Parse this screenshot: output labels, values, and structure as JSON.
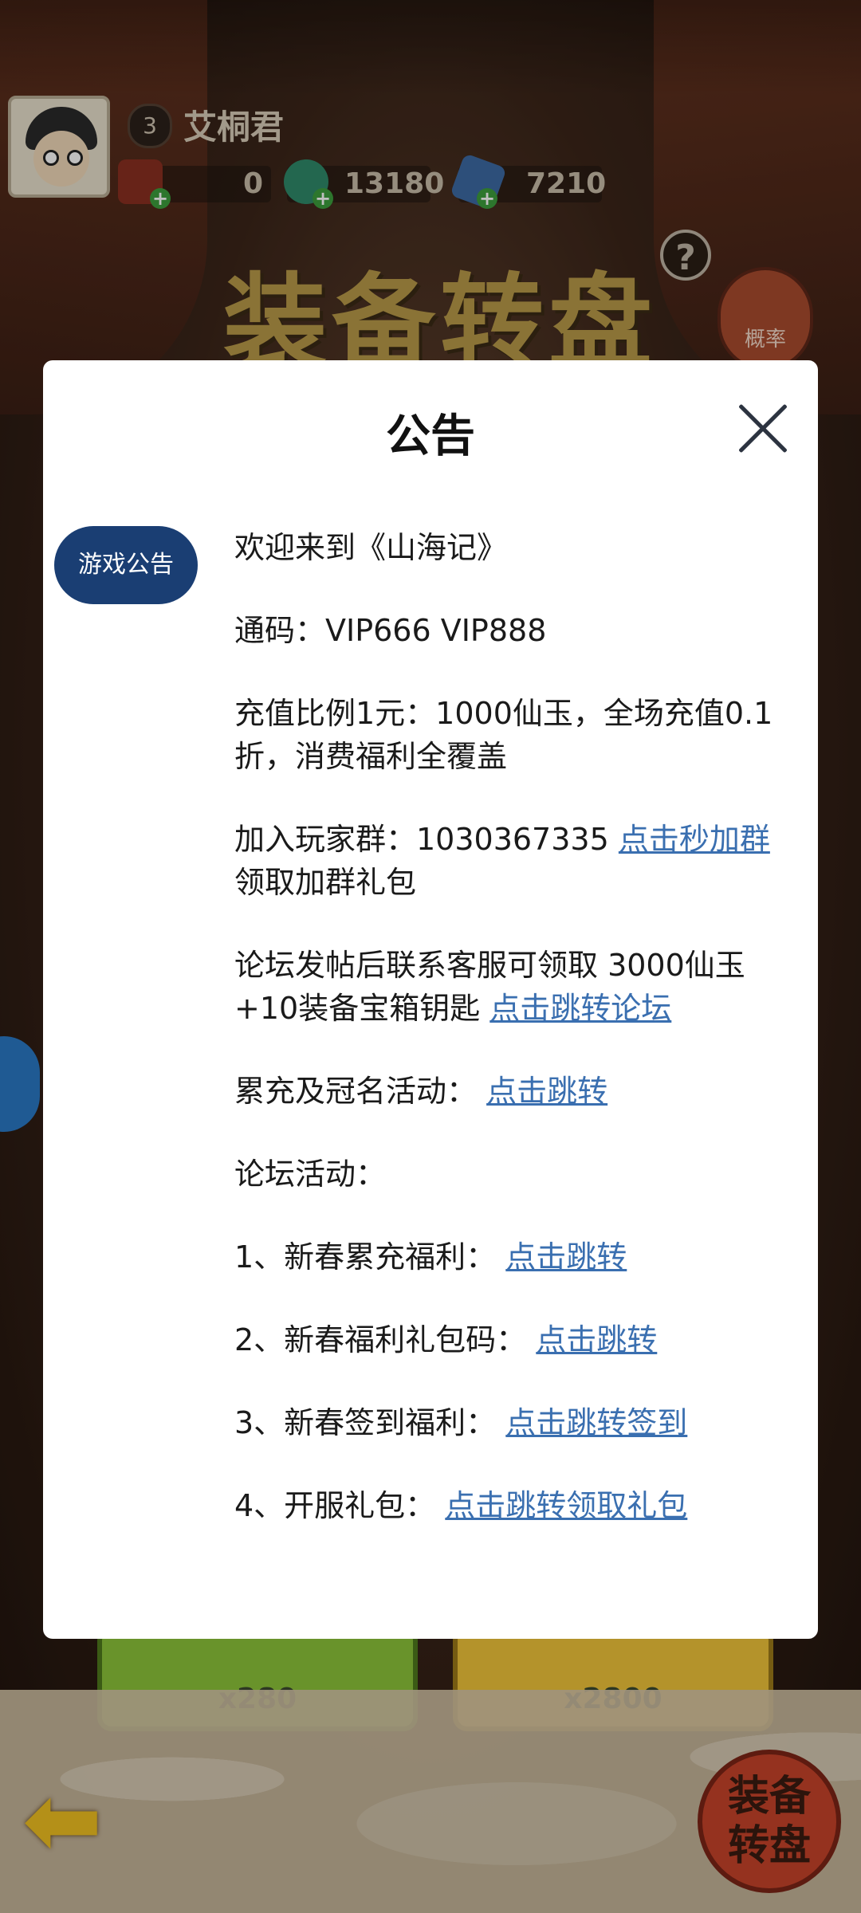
{
  "player": {
    "level": "3",
    "name": "艾桐君"
  },
  "resources": {
    "a": "0",
    "b": "13180",
    "c": "7210"
  },
  "background": {
    "title": "装备转盘",
    "help_symbol": "?",
    "prob_label": "概率",
    "btn_left_cost": "x280",
    "btn_right_cost": "x2800",
    "corner_label_line1": "装备",
    "corner_label_line2": "转盘"
  },
  "dialog": {
    "title": "公告",
    "tab": "游戏公告",
    "p1": "欢迎来到《山海记》",
    "p2": "通码：VIP666 VIP888",
    "p3": "充值比例1元：1000仙玉，全场充值0.1折，消费福利全覆盖",
    "p4_text": "加入玩家群：1030367335 ",
    "p4_link": "点击秒加群",
    "p4_tail": " 领取加群礼包",
    "p5_text": "论坛发帖后联系客服可领取 3000仙玉+10装备宝箱钥匙 ",
    "p5_link": "点击跳转论坛",
    "p6_text": "累充及冠名活动：",
    "p6_link": "点击跳转",
    "p7_text": "论坛活动：",
    "p8_text": "1、新春累充福利：",
    "p8_link": "点击跳转",
    "p9_text": "2、新春福利礼包码：",
    "p9_link": "点击跳转",
    "p10_text": "3、新春签到福利：",
    "p10_link": "点击跳转签到",
    "p11_text": "4、开服礼包：",
    "p11_link": "点击跳转领取礼包"
  },
  "colors": {
    "link": "#3a6fb0",
    "tab": "#1a3e73"
  }
}
